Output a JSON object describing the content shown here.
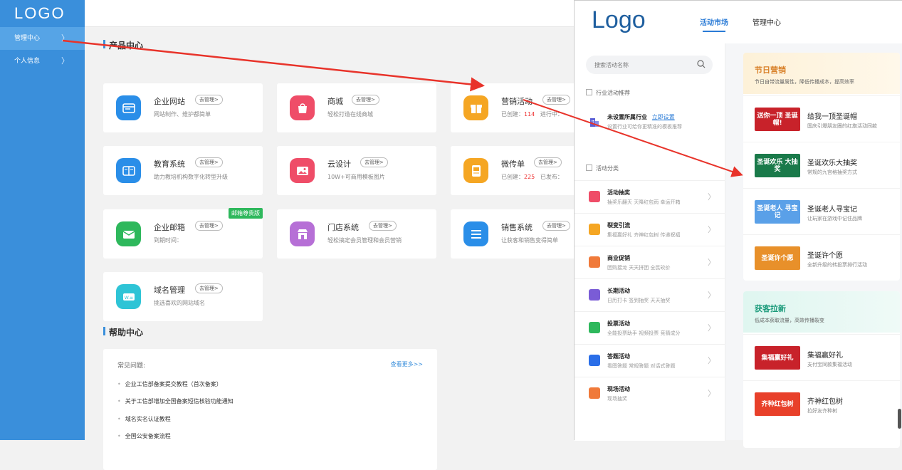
{
  "sidebar": {
    "logo": "LOGO",
    "items": [
      {
        "label": "管理中心",
        "active": true
      },
      {
        "label": "个人信息",
        "active": false
      }
    ]
  },
  "product_center": {
    "title": "产品中心",
    "go_label": "去管理>",
    "cards": [
      {
        "name": "企业网站",
        "desc": "网站制作、维护都简单",
        "icon": "website-icon",
        "color": "#2a8ee8"
      },
      {
        "name": "商城",
        "desc": "轻松打造在线商城",
        "icon": "shop-bag-icon",
        "color": "#ef4d68"
      },
      {
        "name": "营销活动",
        "desc_prefix": "已创建：",
        "desc_count": "114",
        "desc_suffix": "进行中：",
        "icon": "gift-icon",
        "color": "#f5a623"
      },
      {
        "name": "教育系统",
        "desc": "助力教培机构数字化转型升级",
        "icon": "book-icon",
        "color": "#2a8ee8"
      },
      {
        "name": "云设计",
        "desc": "10W+可商用模板图片",
        "icon": "image-icon",
        "color": "#ef4d68"
      },
      {
        "name": "微传单",
        "desc_prefix": "已创建：",
        "desc_count": "225",
        "desc_suffix": "已发布：",
        "icon": "flyer-icon",
        "color": "#f5a623"
      },
      {
        "name": "企业邮箱",
        "desc": "到期时间：",
        "icon": "mail-icon",
        "color": "#2eb85c",
        "ribbon": "邮箱尊贵版"
      },
      {
        "name": "门店系统",
        "desc": "轻松搞定会员管理和会员营销",
        "icon": "store-icon",
        "color": "#b66fd6"
      },
      {
        "name": "销售系统",
        "desc": "让获客和销售变得简单",
        "icon": "list-icon",
        "color": "#2a8ee8"
      },
      {
        "name": "域名管理",
        "desc": "挑选喜欢的网站域名",
        "icon": "domain-icon",
        "color": "#2ec4d6"
      }
    ]
  },
  "help_center": {
    "title": "帮助中心",
    "faq_label": "常见问题:",
    "more_label": "查看更多>>",
    "items": [
      "企业工信部备案提交教程（首次备案）",
      "关于工信部增加全国备案短信核验功能通知",
      "域名实名认证教程",
      "全国公安备案流程"
    ]
  },
  "panel": {
    "logo": "Logo",
    "tabs": [
      "活动市场",
      "管理中心"
    ],
    "search_placeholder": "搜索活动名称",
    "industry_heading": "行业活动推荐",
    "industry_title": "未设置所属行业",
    "industry_link": "立即设置",
    "industry_desc": "设置行业可给你更精准的模板推荐",
    "category_heading": "活动分类",
    "categories": [
      {
        "name": "活动抽奖",
        "desc": "抽奖乐翻天  天降红包雨  幸运开箱",
        "color": "#ef4d68"
      },
      {
        "name": "裂变引流",
        "desc": "集福赢好礼  齐神红包树  传递祝福",
        "color": "#f5a623"
      },
      {
        "name": "商业促销",
        "desc": "团购接龙  天天拼团  全民砍价",
        "color": "#f07a3a"
      },
      {
        "name": "长期活动",
        "desc": "日历打卡  签到抽奖  天天抽奖",
        "color": "#7a5cd6"
      },
      {
        "name": "投票活动",
        "desc": "全能投票助手  视频投票  竞猜成分",
        "color": "#2eb85c"
      },
      {
        "name": "答题活动",
        "desc": "看图答题  常规答题  对话式答题",
        "color": "#2a6ee8"
      },
      {
        "name": "现场活动",
        "desc": "现场抽奖",
        "color": "#f07a3a"
      }
    ],
    "holiday": {
      "title": "节日营销",
      "subtitle": "节日自带流量属性，降低传播成本，提高效率",
      "items": [
        {
          "name": "给我一顶圣诞帽",
          "desc": "国庆引爆朋友圈的红旗活动同款",
          "thumb": "送你一顶 圣诞帽!",
          "color": "#c8222a"
        },
        {
          "name": "圣诞欢乐大抽奖",
          "desc": "常规的九宫格抽奖方式",
          "thumb": "圣诞欢乐 大抽奖",
          "color": "#1a7a4a"
        },
        {
          "name": "圣诞老人寻宝记",
          "desc": "让玩家在游戏中记住品牌",
          "thumb": "圣诞老人 寻宝记",
          "color": "#5aa0e8"
        },
        {
          "name": "圣诞许个愿",
          "desc": "全新升级的转投票排行活动",
          "thumb": "圣诞许个愿",
          "color": "#e8902a"
        }
      ]
    },
    "acquire": {
      "title": "获客拉新",
      "subtitle": "低成本获取流量，高效传播裂变",
      "items": [
        {
          "name": "集福赢好礼",
          "desc": "支付宝同款集福活动",
          "thumb": "集福赢好礼",
          "color": "#c8222a"
        },
        {
          "name": "齐神红包树",
          "desc": "拉好友齐种树",
          "thumb": "齐种红包树",
          "color": "#e8402a"
        }
      ]
    }
  }
}
